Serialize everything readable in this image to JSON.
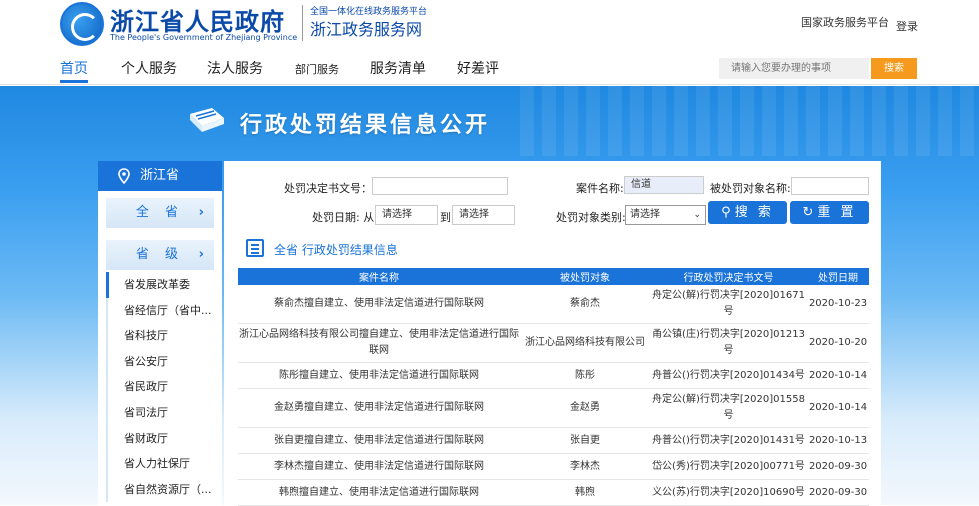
{
  "header": {
    "logo_cn": "浙江省人民政府",
    "logo_en": "The People's Government of Zhejiang Province",
    "sub_line1": "全国一体化在线政务服务平台",
    "sub_line2": "浙江政务服务网",
    "national_platform": "国家政务服务平台",
    "login": "登录"
  },
  "nav": {
    "items": [
      "首页",
      "个人服务",
      "法人服务",
      "部门服务",
      "服务清单",
      "好差评"
    ],
    "search_placeholder": "请输入您要办理的事项",
    "search_button": "搜索"
  },
  "banner": {
    "title": "行政处罚结果信息公开"
  },
  "sidebar": {
    "province": "浙江省",
    "all_button": "全 省",
    "level_button": "省 级",
    "items": [
      "省发展改革委",
      "省经信厅（省中...",
      "省科技厅",
      "省公安厅",
      "省民政厅",
      "省司法厅",
      "省财政厅",
      "省人力社保厅",
      "省自然资源厅（..."
    ]
  },
  "form": {
    "doc_no_label": "处罚决定书文号：",
    "case_name_label": "案件名称:",
    "case_name_value": "信道",
    "target_name_label": "被处罚对象名称:",
    "date_label": "处罚日期: 从",
    "date_to": "到",
    "date_placeholder": "请选择",
    "target_type_label": "处罚对象类别:",
    "target_type_value": "请选择",
    "search_button": "搜 索",
    "reset_button": "重 置"
  },
  "section_title": "全省 行政处罚结果信息",
  "table": {
    "headers": [
      "案件名称",
      "被处罚对象",
      "行政处罚决定书文号",
      "处罚日期"
    ],
    "rows": [
      [
        "蔡俞杰擅自建立、使用非法定信道进行国际联网",
        "蔡俞杰",
        "舟定公(解)行罚决字[2020]01671号",
        "2020-10-23"
      ],
      [
        "浙江心品网络科技有限公司擅自建立、使用非法定信道进行国际联网",
        "浙江心品网络科技有限公司",
        "甬公镇(庄)行罚决字[2020]01213号",
        "2020-10-20"
      ],
      [
        "陈彤擅自建立、使用非法定信道进行国际联网",
        "陈彤",
        "舟普公()行罚决字[2020]01434号",
        "2020-10-14"
      ],
      [
        "金赵勇擅自建立、使用非法定信道进行国际联网",
        "金赵勇",
        "舟定公(解)行罚决字[2020]01558号",
        "2020-10-14"
      ],
      [
        "张自更擅自建立、使用非法定信道进行国际联网",
        "张自更",
        "舟普公()行罚决字[2020]01431号",
        "2020-10-13"
      ],
      [
        "李林杰擅自建立、使用非法定信道进行国际联网",
        "李林杰",
        "岱公(秀)行罚决字[2020]00771号",
        "2020-09-30"
      ],
      [
        "韩煦擅自建立、使用非法定信道进行国际联网",
        "韩煦",
        "义公(苏)行罚决字[2020]10690号",
        "2020-09-30"
      ]
    ]
  },
  "colors": {
    "primary": "#1a73d9",
    "accent": "#f59a1c"
  }
}
